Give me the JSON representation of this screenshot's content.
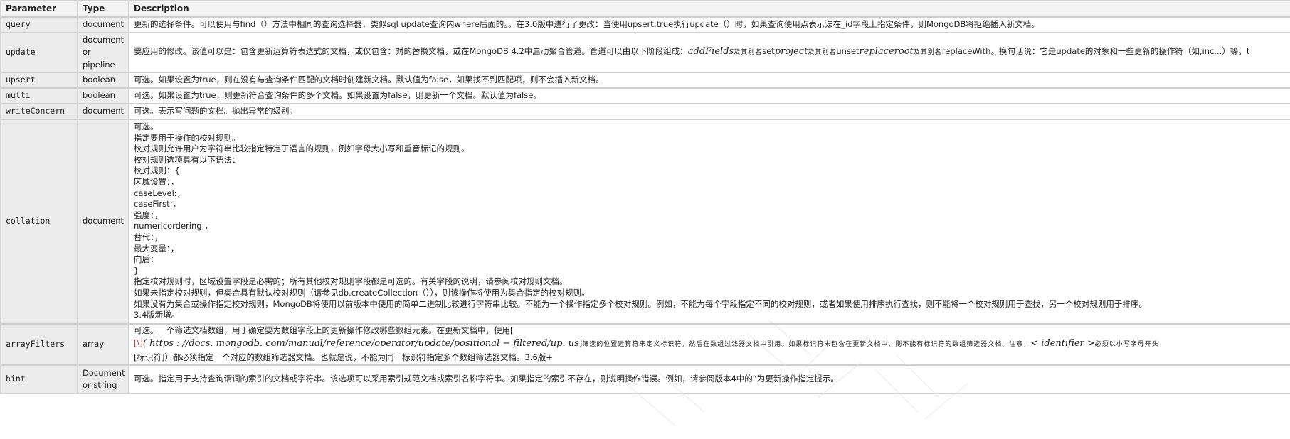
{
  "table": {
    "headers": [
      "Parameter",
      "Type",
      "Description"
    ],
    "rows": [
      {
        "param": "query",
        "type": "document",
        "desc": "更新的选择条件。可以使用与find（）方法中相同的查询选择器，类似sql update查询内where后面的。。在3.0版中进行了更改：当使用upsert:true执行update（）时，如果查询使用点表示法在_id字段上指定条件，则MongoDB将拒绝插入新文档。"
      },
      {
        "param": "update",
        "type_lines": [
          "document",
          "or",
          "pipeline"
        ],
        "desc_parts": {
          "p1": "要应用的修改。该值可以是：包含更新运算符表达式的文档，或仅包含：对的替换文档，或在MongoDB 4.2中启动聚合管道。管道可以由以下阶段组成：",
          "m1": "addFields",
          "t1": "及其别名",
          "p2": "set",
          "m2": "project",
          "t2": "及其别名",
          "p3": "unset",
          "m3": "replaceroot",
          "t3": "及其别名",
          "p4": "replaceWith。换句话说：它是update的对象和一些更新的操作符（如,inc...）等，t"
        }
      },
      {
        "param": "upsert",
        "type": "boolean",
        "desc": "可选。如果设置为true，则在没有与查询条件匹配的文档时创建新文档。默认值为false，如果找不到匹配项，则不会插入新文档。"
      },
      {
        "param": "multi",
        "type": "boolean",
        "desc": "可选。如果设置为true，则更新符合查询条件的多个文档。如果设置为false，则更新一个文档。默认值为false。"
      },
      {
        "param": "writeConcern",
        "type": "document",
        "desc": "可选。表示写问题的文档。抛出异常的级别。"
      },
      {
        "param": "collation",
        "type": "document",
        "desc_lines": [
          "可选。",
          "指定要用于操作的校对规则。",
          "校对规则允许用户为字符串比较指定特定于语言的规则，例如字母大小写和重音标记的规则。",
          "校对规则选项具有以下语法：",
          "校对规则：{",
          "区域设置：，",
          "caseLevel:，",
          "caseFirst:，",
          "强度：，",
          "numericordering:，",
          "替代：，",
          "最大变量：，",
          "向后：",
          "}",
          "指定校对规则时，区域设置字段是必需的；所有其他校对规则字段都是可选的。有关字段的说明，请参阅校对规则文档。",
          "如果未指定校对规则，但集合具有默认校对规则（请参见db.createCollection（）），则该操作将使用为集合指定的校对规则。",
          "如果没有为集合或操作指定校对规则，MongoDB将使用以前版本中使用的简单二进制比较进行字符串比较。不能为一个操作指定多个校对规则。例如，不能为每个字段指定不同的校对规则，或者如果使用排序执行查找，则不能将一个校对规则用于查找，另一个校对规则用于排序。",
          "3.4版新增。"
        ]
      },
      {
        "param": "arrayFilters",
        "type": "array",
        "desc_parts": {
          "line1": "可选。一个筛选文档数组，用于确定要为数组字段上的更新操作修改哪些数组元素。在更新文档中，使用[",
          "bracket_open": "[\\]",
          "math1": "( https : //docs. mongodb. com/manual/reference/operator/update/positional − filtered/up. us",
          "bracket_close": "]",
          "small": "筛选的位置运算符来定义标识符，然后在数组过滤器文档中引用。如果标识符未包含在更新文档中，则不能有标识符的数组筛选器文档。注意，",
          "math2": "< identifier >",
          "small2": "必须以小写字母开头",
          "line3": "[标识符]）都必须指定一个对应的数组筛选器文档。也就是说，不能为同一标识符指定多个数组筛选器文档。3.6版+"
        }
      },
      {
        "param": "hint",
        "type_lines": [
          "Document",
          "or string"
        ],
        "desc": "可选。指定用于支持查询谓词的索引的文档或字符串。该选项可以采用索引规范文档或索引名称字符串。如果指定的索引不存在，则说明操作错误。例如，请参阅版本4中的“为更新操作指定提示。"
      }
    ]
  }
}
